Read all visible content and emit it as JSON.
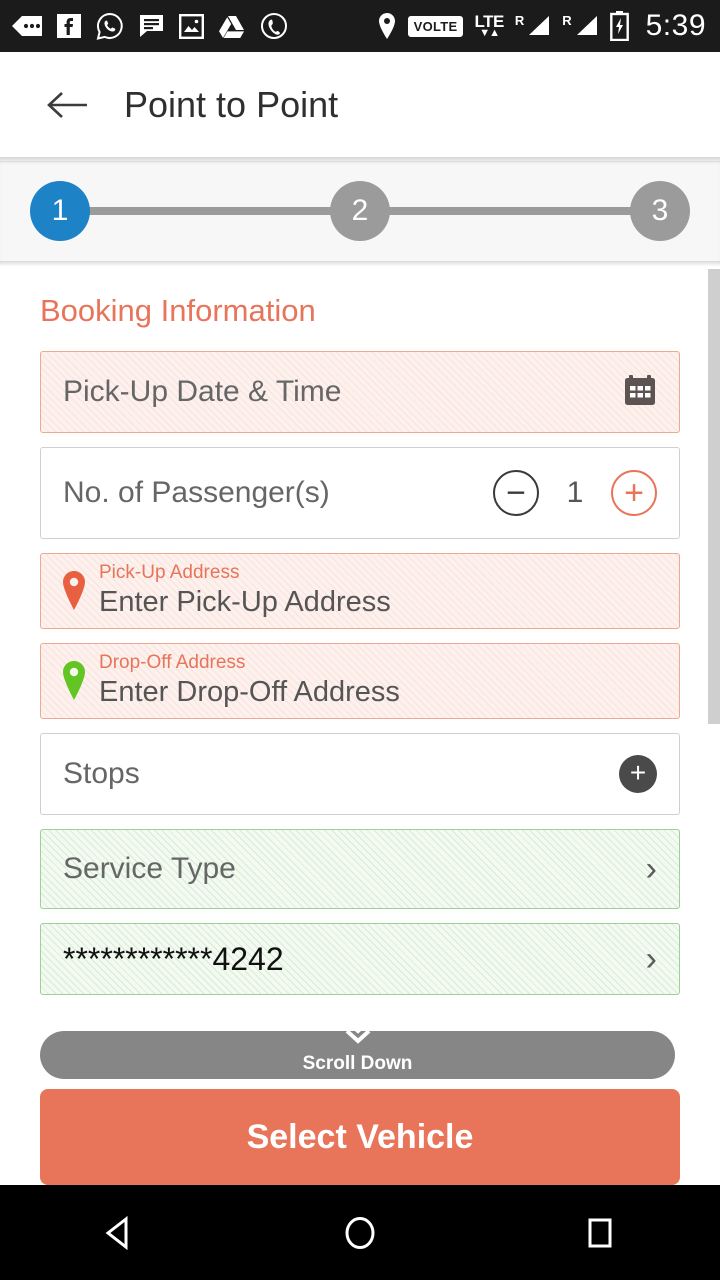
{
  "status_bar": {
    "time": "5:39",
    "network_badge": "VOLTE",
    "network_type": "LTE",
    "roaming_label_1": "R",
    "roaming_label_2": "R",
    "left_icons": [
      "more-dots-icon",
      "facebook-icon",
      "whatsapp-icon",
      "sms-message-icon",
      "gallery-photo-icon",
      "google-drive-icon",
      "phone-call-icon"
    ],
    "right_icons": [
      "location-pin-icon",
      "volte-badge-icon",
      "lte-data-icon",
      "signal-bars-1-icon",
      "signal-bars-2-icon",
      "battery-charging-icon"
    ]
  },
  "app_bar": {
    "back_icon": "back-arrow-icon",
    "title": "Point to Point"
  },
  "stepper": {
    "steps": [
      {
        "label": "1",
        "state": "active"
      },
      {
        "label": "2",
        "state": "inactive"
      },
      {
        "label": "3",
        "state": "inactive"
      }
    ],
    "active_color": "#1d82c6",
    "inactive_color": "#9b9b9b"
  },
  "form": {
    "section_title": "Booking Information",
    "pickup_datetime": {
      "placeholder": "Pick-Up Date & Time",
      "icon": "calendar-icon",
      "state": "error"
    },
    "passengers": {
      "label": "No. of Passenger(s)",
      "value": "1",
      "decrement_label": "−",
      "increment_label": "+"
    },
    "pickup_address": {
      "label": "Pick-Up Address",
      "placeholder": "Enter Pick-Up Address",
      "pin_color": "#e8603f",
      "state": "error"
    },
    "dropoff_address": {
      "label": "Drop-Off Address",
      "placeholder": "Enter Drop-Off Address",
      "pin_color": "#62c523",
      "state": "error"
    },
    "stops": {
      "label": "Stops",
      "add_label": "+"
    },
    "service_type": {
      "label": "Service Type",
      "chevron": "›",
      "state": "valid"
    },
    "payment_card": {
      "value": "************4242",
      "chevron": "›",
      "state": "valid"
    }
  },
  "scroll_hint": {
    "label": "Scroll Down",
    "chevrons": "˅˅"
  },
  "primary_action": {
    "label": "Select Vehicle",
    "color": "#e8745a"
  },
  "nav_bar": {
    "back": "nav-back-icon",
    "home": "nav-home-icon",
    "recents": "nav-recents-icon"
  },
  "colors": {
    "accent": "#e8745a",
    "valid_green": "#60af50",
    "step_active": "#1d82c6"
  }
}
